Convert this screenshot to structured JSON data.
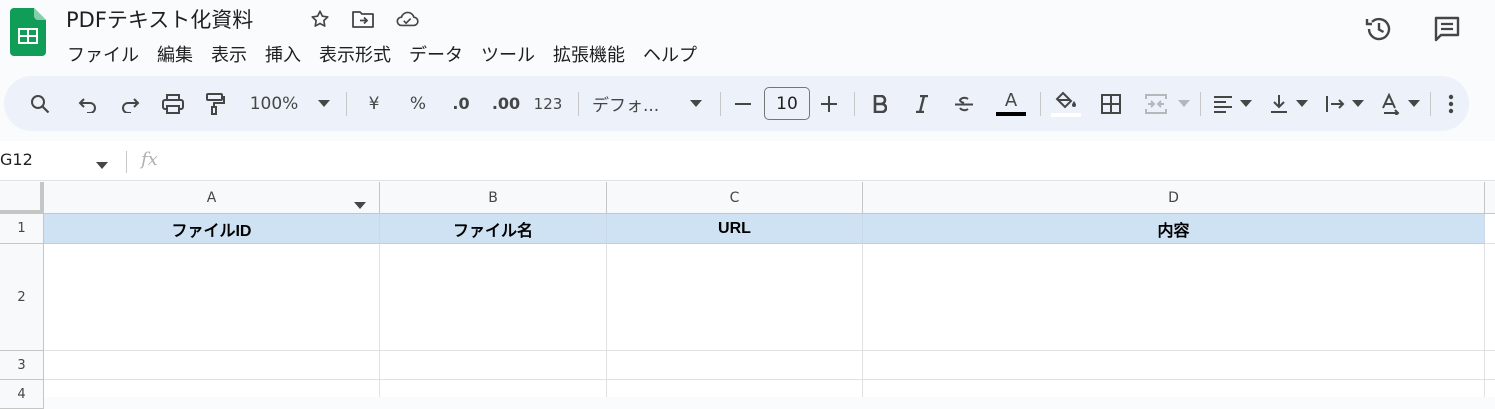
{
  "document": {
    "title": "PDFテキスト化資料"
  },
  "menu": [
    "ファイル",
    "編集",
    "表示",
    "挿入",
    "表示形式",
    "データ",
    "ツール",
    "拡張機能",
    "ヘルプ"
  ],
  "toolbar": {
    "zoom": "100%",
    "currency": "¥",
    "percent": "%",
    "dec_decrease": ".0",
    "dec_increase": ".00",
    "number_format": "123",
    "font": "デフォ...",
    "font_size": "10",
    "text_color_label": "A",
    "text_color": "#000000",
    "highlight_color": "#ffffff",
    "accent": "#edf2fa"
  },
  "formula_bar": {
    "cell_ref": "G12",
    "fx_label": "fx",
    "value": ""
  },
  "grid": {
    "columns": [
      "A",
      "B",
      "C",
      "D"
    ],
    "rows": [
      "1",
      "2",
      "3",
      "4"
    ],
    "header_row": [
      "ファイルID",
      "ファイル名",
      "URL",
      "内容"
    ],
    "header_fill": "#cfe2f3"
  }
}
